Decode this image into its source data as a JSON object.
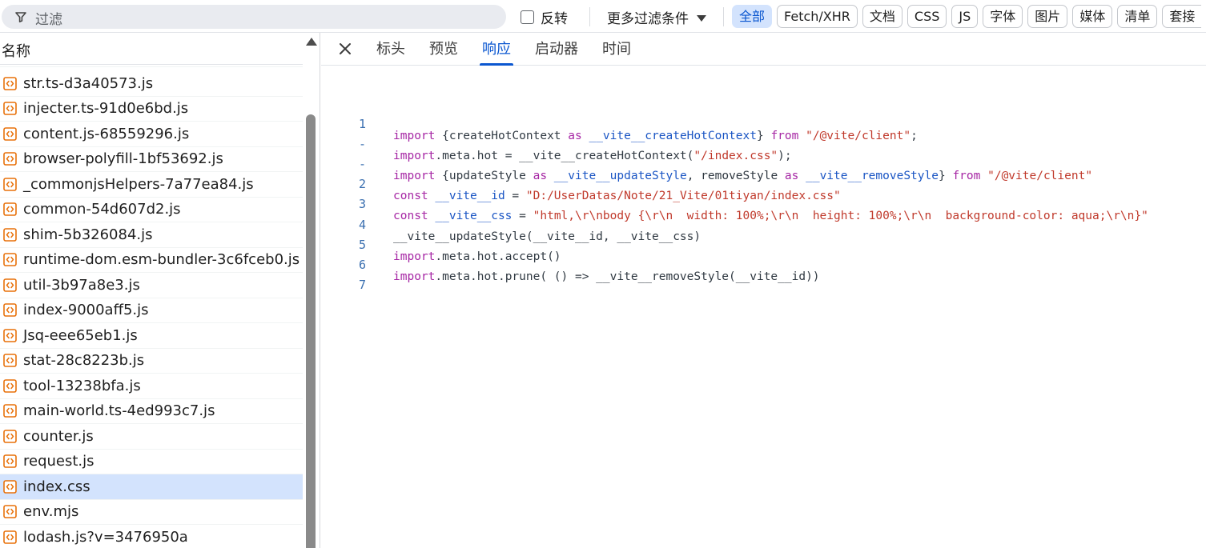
{
  "toolbar": {
    "filter_placeholder": "过滤",
    "invert_label": "反转",
    "more_filters_label": "更多过滤条件",
    "chips": [
      {
        "label": "全部",
        "active": true
      },
      {
        "label": "Fetch/XHR",
        "active": false
      },
      {
        "label": "文档",
        "active": false
      },
      {
        "label": "CSS",
        "active": false
      },
      {
        "label": "JS",
        "active": false
      },
      {
        "label": "字体",
        "active": false
      },
      {
        "label": "图片",
        "active": false
      },
      {
        "label": "媒体",
        "active": false
      },
      {
        "label": "清单",
        "active": false
      },
      {
        "label": "套接",
        "active": false
      }
    ]
  },
  "request_list": {
    "column_header": "名称",
    "items": [
      "str.ts-d3a40573.js",
      "injecter.ts-91d0e6bd.js",
      "content.js-68559296.js",
      "browser-polyfill-1bf53692.js",
      "_commonjsHelpers-7a77ea84.js",
      "common-54d607d2.js",
      "shim-5b326084.js",
      "runtime-dom.esm-bundler-3c6fceb0.js",
      "util-3b97a8e3.js",
      "index-9000aff5.js",
      "Jsq-eee65eb1.js",
      "stat-28c8223b.js",
      "tool-13238bfa.js",
      "main-world.ts-4ed993c7.js",
      "counter.js",
      "request.js",
      "index.css",
      "env.mjs",
      "lodash.js?v=3476950a"
    ],
    "selected": "index.css"
  },
  "detail_tabs": [
    {
      "label": "标头",
      "active": false
    },
    {
      "label": "预览",
      "active": false
    },
    {
      "label": "响应",
      "active": true
    },
    {
      "label": "启动器",
      "active": false
    },
    {
      "label": "时间",
      "active": false
    }
  ],
  "code": {
    "line_numbers": [
      "1",
      "-",
      "-",
      "2",
      "3",
      "4",
      "5",
      "6",
      "7"
    ],
    "l1": {
      "a": "import",
      "b": " {createHotContext ",
      "c": "as",
      "d": " __vite__createHotContext",
      "e": "} ",
      "f": "from",
      "g": " ",
      "h": "\"/@vite/client\"",
      "i": ";"
    },
    "l2": {
      "a": "import",
      "b": ".meta.hot = __vite__createHotContext(",
      "c": "\"/index.css\"",
      "d": ");"
    },
    "l3": {
      "a": "import",
      "b": " {updateStyle ",
      "c": "as",
      "d": " __vite__updateStyle",
      "e": ", removeStyle ",
      "f": "as",
      "g": " __vite__removeStyle",
      "h": "} ",
      "i": "from",
      "j": " ",
      "k": "\"/@vite/client\""
    },
    "l4": {
      "a": "const",
      "b": " __vite__id",
      "c": " = ",
      "d": "\"D:/UserDatas/Note/21_Vite/01tiyan/index.css\""
    },
    "l5": {
      "a": "const",
      "b": " __vite__css",
      "c": " = ",
      "d": "\"html,\\r\\nbody {\\r\\n  width: 100%;\\r\\n  height: 100%;\\r\\n  background-color: aqua;\\r\\n}\""
    },
    "l6": "__vite__updateStyle(__vite__id, __vite__css)",
    "l7": {
      "a": "import",
      "b": ".meta.hot.accept()"
    },
    "l8": {
      "a": "import",
      "b": ".meta.hot.prune( () => __vite__removeStyle(__vite__id))"
    }
  },
  "colors": {
    "accent": "#0b57d0",
    "selected_row": "#d3e3fd",
    "file_icon": "#e8710a",
    "keyword": "#a626a4",
    "string": "#c0392b"
  }
}
